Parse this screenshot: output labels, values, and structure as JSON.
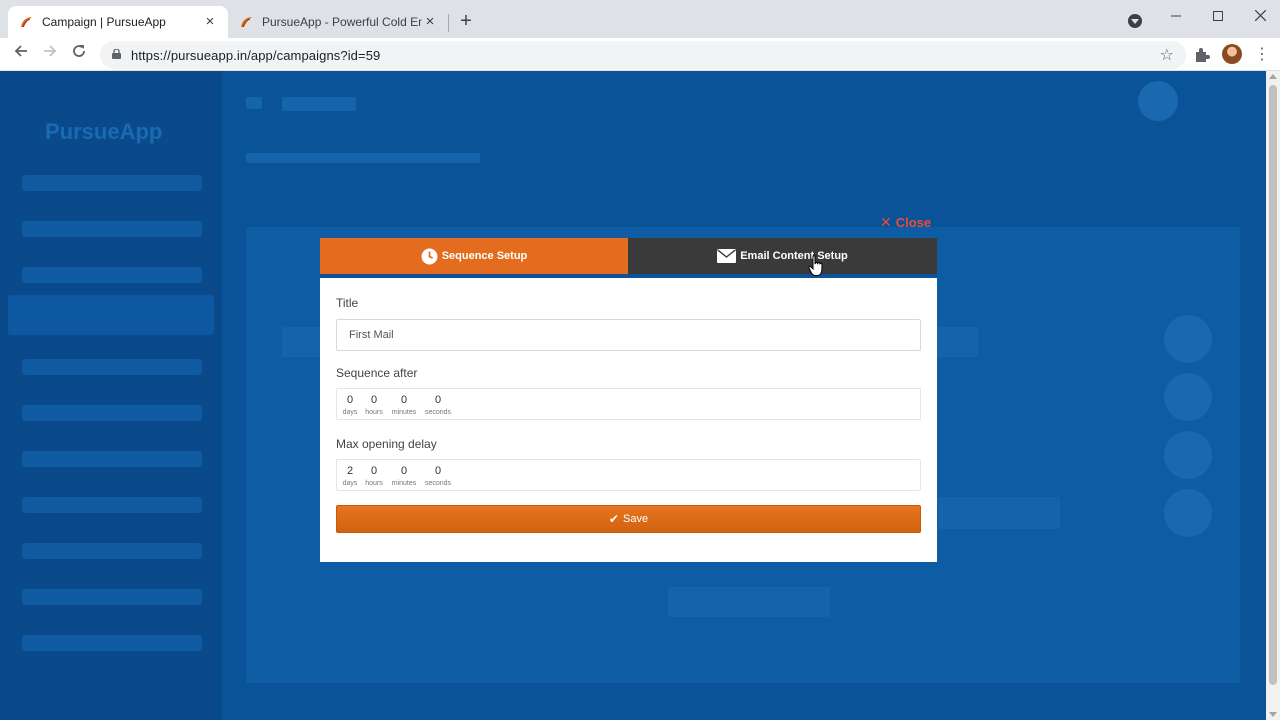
{
  "browser": {
    "tabs": [
      {
        "title": "Campaign | PursueApp",
        "active": true
      },
      {
        "title": "PursueApp - Powerful Cold Emai",
        "active": false
      }
    ],
    "url": "https://pursueapp.in/app/campaigns?id=59",
    "new_tab_symbol": "+",
    "tab_close_symbol": "×"
  },
  "background_app": {
    "logo_text": "PursueApp"
  },
  "modal": {
    "close_label": "Close",
    "tabs": {
      "sequence_setup": "Sequence Setup",
      "email_content_setup": "Email Content Setup"
    },
    "title_label": "Title",
    "title_value": "First Mail",
    "sequence_after": {
      "label": "Sequence after",
      "days": "0",
      "hours": "0",
      "minutes": "0",
      "seconds": "0"
    },
    "max_opening_delay": {
      "label": "Max opening delay",
      "days": "2",
      "hours": "0",
      "minutes": "0",
      "seconds": "0"
    },
    "unit_labels": {
      "days": "days",
      "hours": "hours",
      "minutes": "minutes",
      "seconds": "seconds"
    },
    "save_label": "Save"
  },
  "colors": {
    "accent_orange": "#e36c1e",
    "close_red": "#e74c3c",
    "overlay_blue": "#0b5398",
    "tab_dark": "#3a3a3a"
  }
}
